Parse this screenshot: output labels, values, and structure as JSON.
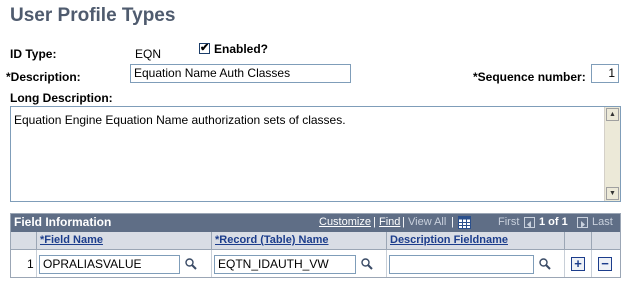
{
  "page": {
    "title": "User Profile Types"
  },
  "form": {
    "id_type_label": "ID Type:",
    "id_type_value": "EQN",
    "enabled_label": "Enabled?",
    "enabled_checked": "✔",
    "description_label": "*Description:",
    "description_value": "Equation Name Auth Classes",
    "sequence_label": "*Sequence number:",
    "sequence_value": "1",
    "long_description_label": "Long Description:",
    "long_description_value": "Equation Engine Equation Name authorization sets of classes."
  },
  "grid": {
    "title": "Field Information",
    "nav": {
      "customize": "Customize",
      "sep1": "|",
      "find": "Find",
      "sep2": "|",
      "view_all": "View All",
      "sep3": "|",
      "first": "First",
      "range": "1 of 1",
      "last": "Last"
    },
    "columns": [
      "*Field Name",
      "*Record (Table) Name",
      "Description Fieldname"
    ],
    "rows": [
      {
        "num": "1",
        "field_name": "OPRALIASVALUE",
        "record_name": "EQTN_IDAUTH_VW",
        "description_fieldname": ""
      }
    ],
    "add_symbol": "+",
    "delete_symbol": "−"
  }
}
